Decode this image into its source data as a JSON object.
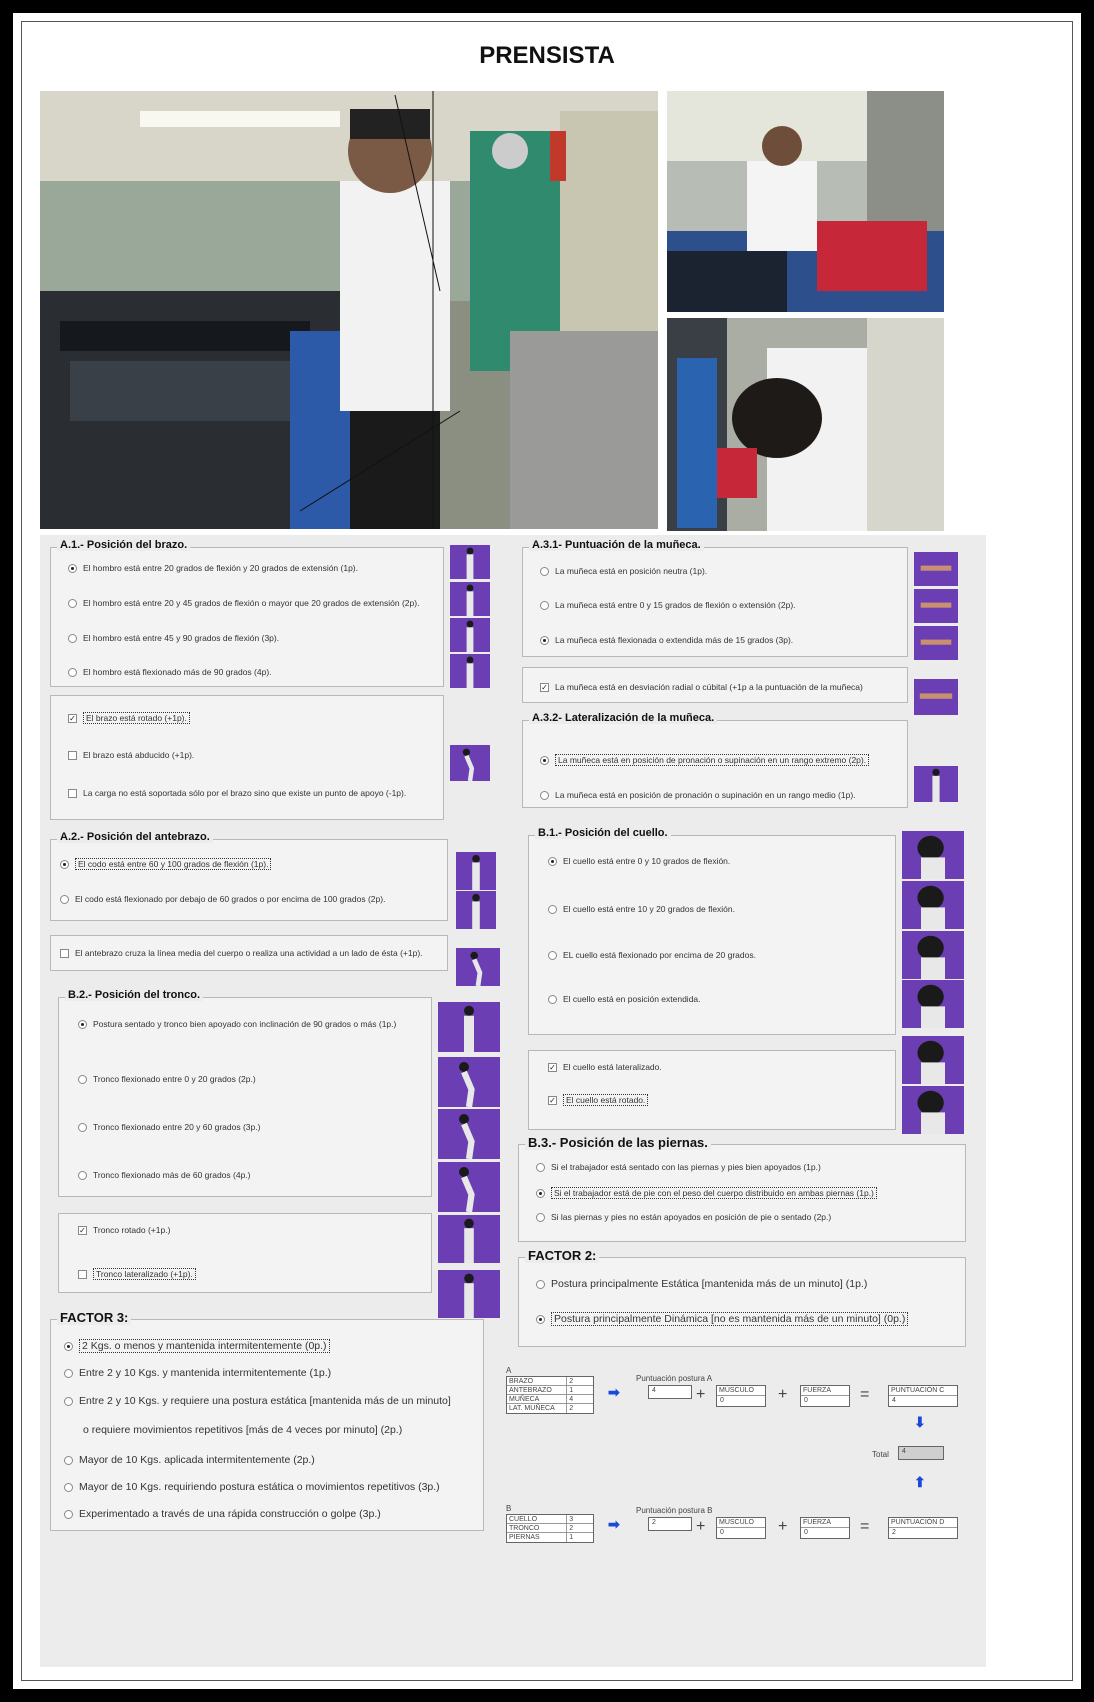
{
  "title": "PRENSISTA",
  "a1": {
    "legend": "A.1.- Posición del brazo.",
    "options": [
      "El hombro está entre 20 grados de flexión y 20 grados de extensión (1p).",
      "El hombro está entre 20 y 45 grados de flexión o mayor que 20 grados de extensión (2p).",
      "El hombro  está entre 45 y 90 grados de flexión (3p).",
      "El hombro está flexionado más de 90 grados (4p)."
    ],
    "selected": 0,
    "mods": [
      {
        "label": "El brazo está rotado  (+1p).",
        "checked": true
      },
      {
        "label": "El brazo está abducido  (+1p).",
        "checked": false
      },
      {
        "label": "La carga no está soportada sólo por el brazo sino que existe un punto de apoyo (-1p).",
        "checked": false
      }
    ]
  },
  "a31": {
    "legend": "A.3.1- Puntuación de la muñeca.",
    "options": [
      "La muñeca está en posición neutra (1p).",
      "La muñeca está entre 0 y 15 grados de flexión o extensión (2p).",
      "La muñeca está flexionada o extendida más de 15 grados  (3p)."
    ],
    "selected": 2,
    "mod": {
      "label": "La muñeca está en desviación radial o cúbital (+1p a la puntuación de la muñeca)",
      "checked": true
    }
  },
  "a32": {
    "legend": "A.3.2- Lateralización de la muñeca.",
    "options": [
      "La muñeca está en posición de pronación o supinación en un rango extremo (2p).",
      "La muñeca está en posición de pronación o supinación en un rango medio (1p)."
    ],
    "selected": 0
  },
  "a2": {
    "legend": "A.2.- Posición del antebrazo.",
    "options": [
      "El codo está entre 60 y 100 grados de flexión (1p).",
      "El codo está flexionado por debajo de 60 grados o por encima de 100 grados (2p)."
    ],
    "selected": 0,
    "mod": {
      "label": "El antebrazo cruza la línea media del cuerpo o realiza una actividad a un lado de ésta  (+1p).",
      "checked": false
    }
  },
  "b1": {
    "legend": "B.1.- Posición del cuello.",
    "options": [
      "El cuello está entre 0 y 10 grados de flexión.",
      "El cuello está entre 10 y 20 grados de flexión.",
      "EL cuello está flexionado por encima de 20 grados.",
      "El cuello está en posición extendida."
    ],
    "selected": 0,
    "mods": [
      {
        "label": "El cuello está lateralizado.",
        "checked": true
      },
      {
        "label": "El cuello está rotado.",
        "checked": true
      }
    ]
  },
  "b2": {
    "legend": "B.2.- Posición del tronco.",
    "options": [
      "Postura sentado y tronco bien apoyado con inclinación de 90 grados o más (1p.)",
      "Tronco flexionado entre 0 y 20 grados (2p.)",
      "Tronco flexionado  entre 20 y 60 grados (3p.)",
      "Tronco flexionado más de 60 grados (4p.)"
    ],
    "selected": 0,
    "mods": [
      {
        "label": "Tronco rotado (+1p.)",
        "checked": true
      },
      {
        "label": "Tronco lateralizado (+1p).",
        "checked": false
      }
    ]
  },
  "b3": {
    "legend": "B.3.- Posición de las piernas.",
    "options": [
      "Si el trabajador está sentado con las piernas y pies bien apoyados (1p.)",
      "Si el trabajador está de pie con el peso del cuerpo distribuido en ambas piernas  (1p.)",
      "Si las piernas y pies no están apoyados en posición de pie o sentado (2p.)"
    ],
    "selected": 1
  },
  "factor2": {
    "legend": "FACTOR 2:",
    "options": [
      "Postura principalmente Estática [mantenida más de un minuto] (1p.)",
      "Postura principalmente Dinámica [no es mantenida más de un minuto] (0p.)"
    ],
    "selected": 1
  },
  "factor3": {
    "legend": "FACTOR 3:",
    "options": [
      "2 Kgs. o menos y mantenida intermitentemente (0p.)",
      "Entre 2 y 10 Kgs. y mantenida intermitentemente (1p.)",
      "Entre 2 y 10 Kgs. y requiere una postura estática [mantenida más de un minuto]",
      "Mayor de 10 Kgs. aplicada intermitentemente (2p.)",
      "Mayor de 10 Kgs. requiriendo postura estática o movimientos repetitivos (3p.)",
      "Experimentado a través de una rápida construcción o golpe (3p.)"
    ],
    "continuation": "o requiere movimientos repetitivos [más de 4 veces por minuto] (2p.)",
    "selected": 0
  },
  "scoreA": {
    "label": "A",
    "rows": [
      {
        "k": "BRAZO",
        "v": "2"
      },
      {
        "k": "ANTEBRAZO",
        "v": "1"
      },
      {
        "k": "MUÑECA",
        "v": "4"
      },
      {
        "k": "LAT. MUÑECA",
        "v": "2"
      }
    ],
    "posture_label": "Puntuación postura A",
    "posture_value": "4",
    "musculo_label": "MÚSCULO",
    "musculo_value": "0",
    "fuerza_label": "FUERZA",
    "fuerza_value": "0",
    "result_label": "PUNTUACIÓN C",
    "result_value": "4"
  },
  "scoreB": {
    "label": "B",
    "rows": [
      {
        "k": "CUELLO",
        "v": "3"
      },
      {
        "k": "TRONCO",
        "v": "2"
      },
      {
        "k": "PIERNAS",
        "v": "1"
      }
    ],
    "posture_label": "Puntuación postura B",
    "posture_value": "2",
    "musculo_label": "MÚSCULO",
    "musculo_value": "0",
    "fuerza_label": "FUERZA",
    "fuerza_value": "0",
    "result_label": "PUNTUACIÓN D",
    "result_value": "2"
  },
  "total": {
    "label": "Total",
    "value": "4"
  },
  "colors": {
    "thumb_bg": "#6b3fb3",
    "arrow": "#1a49d9",
    "panel": "#ececec"
  }
}
